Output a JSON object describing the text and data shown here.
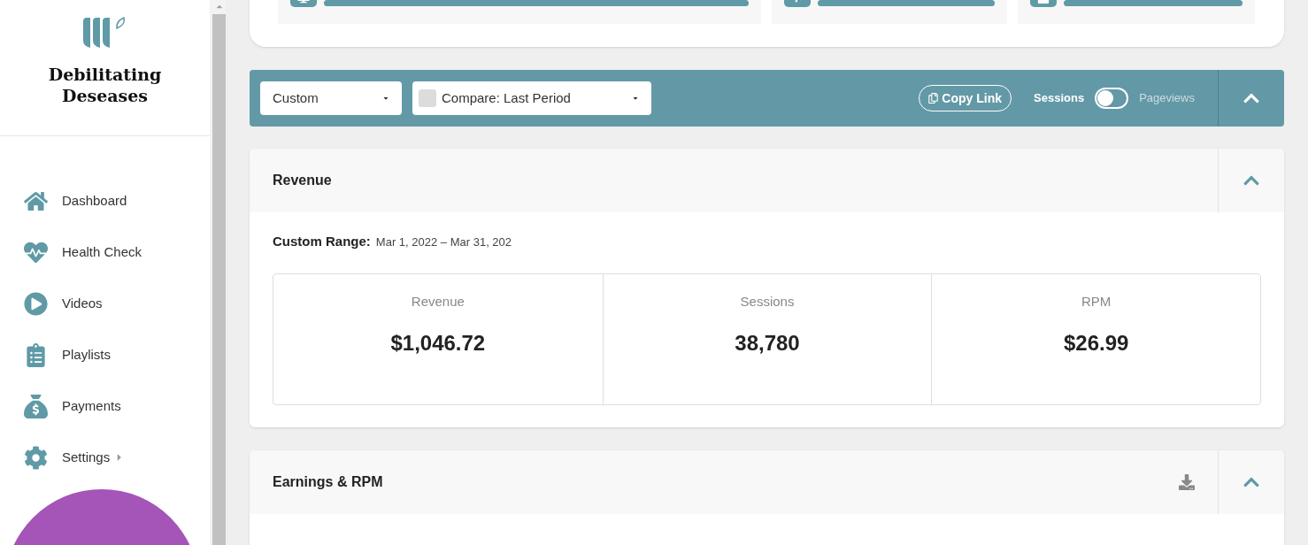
{
  "brand": {
    "name": "Debilitating Deseases"
  },
  "sidebar": {
    "items": [
      {
        "label": "Dashboard",
        "has_submenu": false
      },
      {
        "label": "Health Check",
        "has_submenu": false
      },
      {
        "label": "Videos",
        "has_submenu": false
      },
      {
        "label": "Playlists",
        "has_submenu": false
      },
      {
        "label": "Payments",
        "has_submenu": false
      },
      {
        "label": "Settings",
        "has_submenu": true
      }
    ]
  },
  "toolbar": {
    "range_select": "Custom",
    "compare_select": "Compare: Last Period",
    "compare_checked": false,
    "copy_link": "Copy Link",
    "toggle_left": "Sessions",
    "toggle_right": "Pageviews",
    "toggle_on": false
  },
  "revenue": {
    "title": "Revenue",
    "range_label": "Custom Range:",
    "range_value": "Mar 1, 2022 – Mar 31, 202",
    "metrics": [
      {
        "label": "Revenue",
        "value": "$1,046.72"
      },
      {
        "label": "Sessions",
        "value": "38,780"
      },
      {
        "label": "RPM",
        "value": "$26.99"
      }
    ]
  },
  "earnings": {
    "title": "Earnings & RPM"
  }
}
